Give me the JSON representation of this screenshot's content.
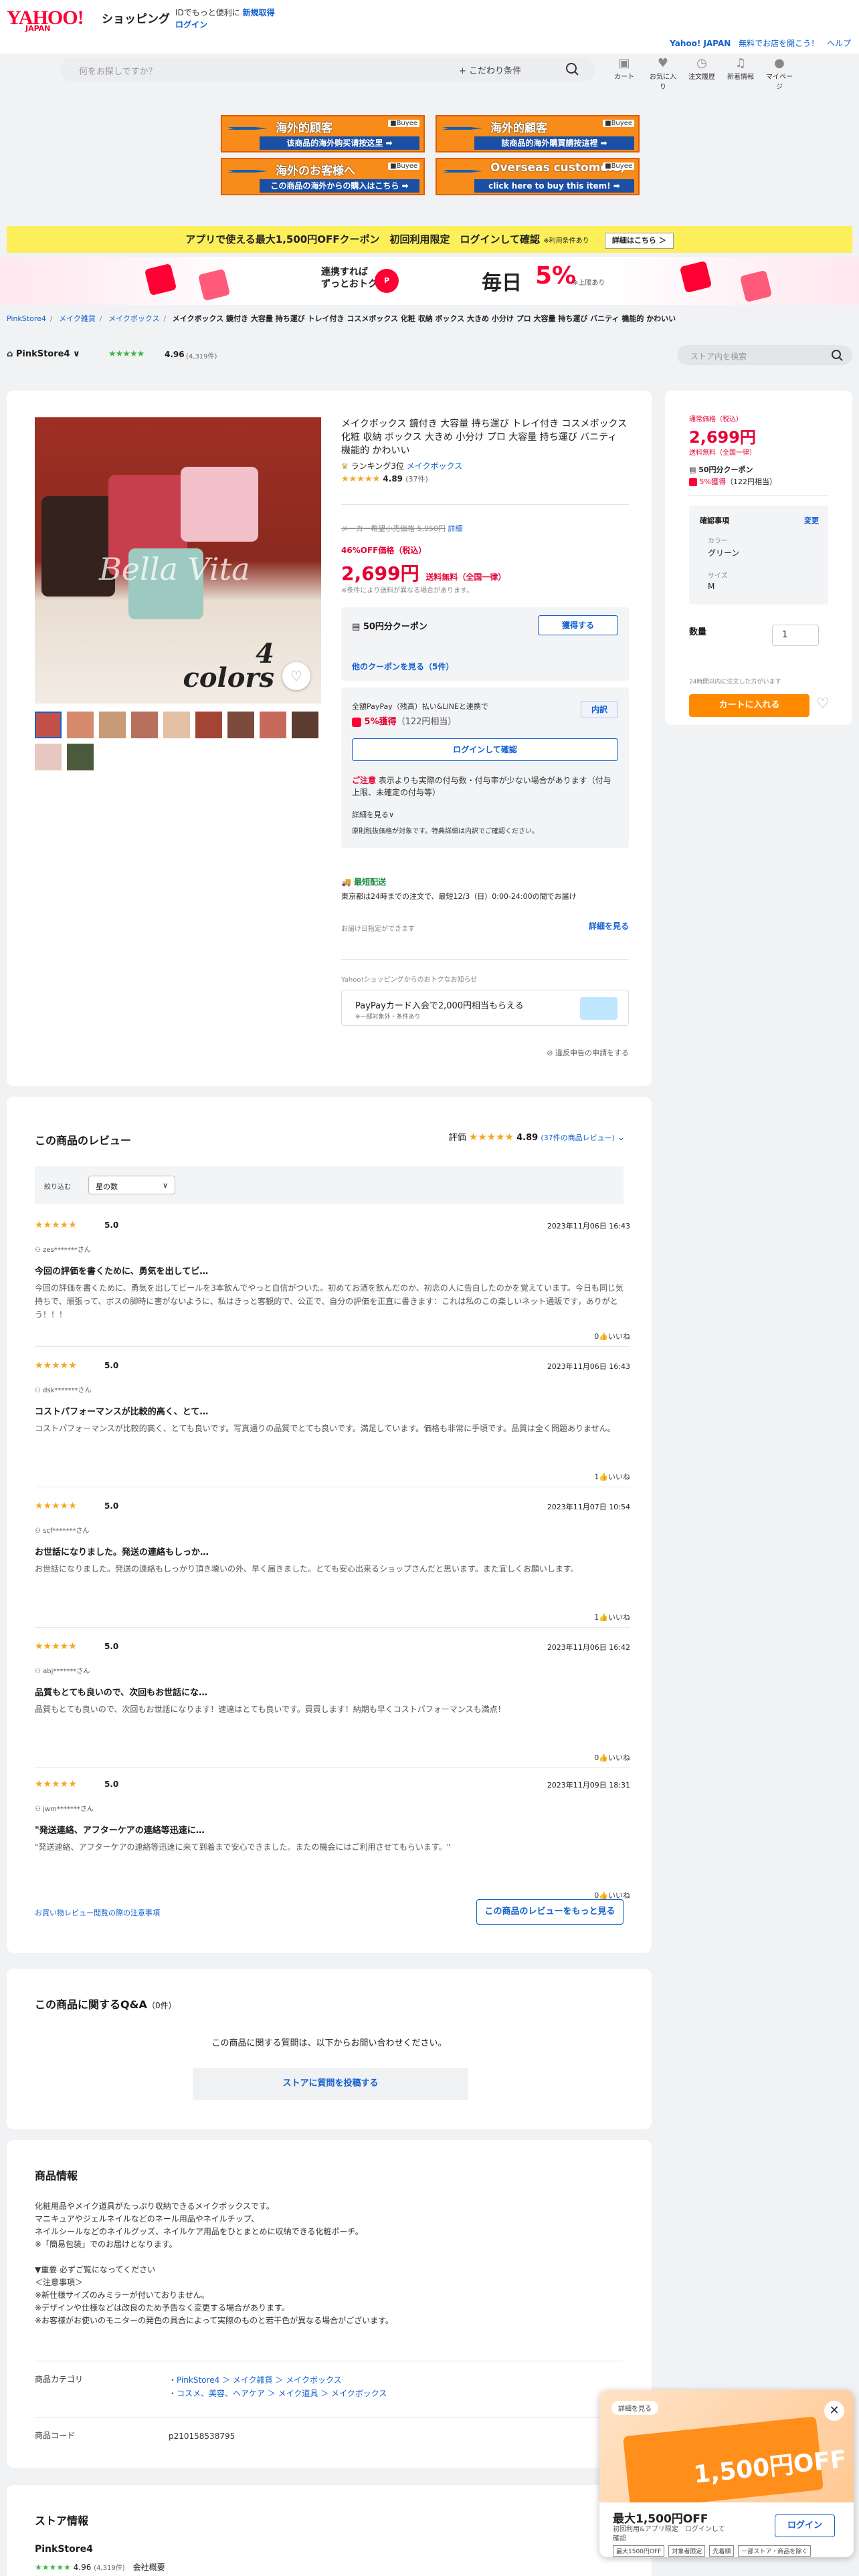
{
  "header": {
    "logo_text": "YAHOO!",
    "logo_sub": "JAPAN",
    "shop_label": "ショッピング",
    "promo_text": "IDでもっと便利に",
    "promo_link": "新規取得",
    "login": "ログイン",
    "yj_link": "Yahoo! JAPAN",
    "yj_link2": "無料でお店を開こう！",
    "help_link": "ヘルプ",
    "search_placeholder": "何をお探しですか？",
    "search_conditions": "+ こだわり条件",
    "nav": [
      {
        "icon": "cart-icon",
        "label": "カート"
      },
      {
        "icon": "heart-icon",
        "label": "お気に入り"
      },
      {
        "icon": "history-icon",
        "label": "注文履歴"
      },
      {
        "icon": "bell-icon",
        "label": "新着情報"
      },
      {
        "icon": "user-icon",
        "label": "マイページ"
      }
    ]
  },
  "ads": [
    {
      "title": "海外的顾客",
      "sub": "该商品的海外购买请按这里 ➡",
      "tag": "■Buyee"
    },
    {
      "title": "海外的顧客",
      "sub": "該商品的海外購買請按這裡 ➡",
      "tag": "■Buyee"
    },
    {
      "title": "海外のお客様へ",
      "sub": "この商品の海外からの購入はこちら ➡",
      "tag": "■Buyee"
    },
    {
      "title": "Overseas customers,",
      "sub": "click here to buy this item! ➡",
      "tag": "■Buyee"
    }
  ],
  "coupon_bar": {
    "text": "アプリで使える最大1,500円OFFクーポン　初回利用限定　ログインして確認",
    "note": "※利用条件あり",
    "detail": "詳細はこちら ＞"
  },
  "pay_banner": {
    "text": "連携すれば\nずっとおトク",
    "daily": "毎日",
    "percent": "5%",
    "note": "※上限あり"
  },
  "breadcrumb": [
    "PinkStore4",
    "メイク雑貨",
    "メイクボックス"
  ],
  "breadcrumb_current": "メイクボックス 鏡付き 大容量 持ち運び トレイ付き コスメボックス 化粧 収納 ボックス 大きめ 小分け プロ 大容量 持ち運び バニティ 機能的 かわいい",
  "store": {
    "name": "PinkStore4",
    "stars": "★★★★★",
    "rating": "4.96",
    "count": "(4,319件)",
    "search_placeholder": "ストア内を検索"
  },
  "product": {
    "title": "メイクボックス 鏡付き 大容量 持ち運び トレイ付き コスメボックス 化粧 収納 ボックス 大きめ 小分け プロ 大容量 持ち運び バニティ 機能的 かわいい",
    "rank_label": "ランキング3位",
    "rank_cat": "メイクボックス",
    "stars": "★★★★★",
    "rating": "4.89",
    "review_count": "(37件)",
    "image_text": "Bella Vita",
    "colors_text": "4\ncolors",
    "orig_price": "メーカー希望小売価格 5,950円",
    "orig_detail": "詳細",
    "discount": "46%OFF価格（税込）",
    "price": "2,699円",
    "ship": "送料無料（全国一律）",
    "note": "※条件により送料が異なる場合があります。",
    "coupon_title": "50円分クーポン",
    "coupon_get": "獲得する",
    "coupon_more": "他のクーポンを見る（5件）",
    "pay_line1": "全額PayPay（残高）払い&LINEと連携で",
    "pay_line2": "5%獲得",
    "pay_points": "（122円相当）",
    "pay_detail": "内訳",
    "pay_login": "ログインして確認",
    "caution_label": "ご注意",
    "caution": "表示よりも実際の付与数・付与率が少ない場合があります（付与上限、未確定の付与等）",
    "caution_more": "詳細を見る∨",
    "caution_foot": "原則税抜価格が対象です。特典詳細は内訳でご確認ください。",
    "ship_title": "最短配送",
    "ship_body": "東京都は24時までの注文で、最短12/3（日）0:00-24:00の間でお届け",
    "ship_date": "お届け日指定ができます",
    "ship_more": "詳細を見る",
    "yj_note": "Yahoo!ショッピングからのおトクなお知らせ",
    "card_offer": "PayPayカード入会で2,000円相当もらえる",
    "card_offer_sub": "※一部対象外・条件あり",
    "report": "⊘ 違反申告の申請をする"
  },
  "cart": {
    "label": "通常価格（税込）",
    "price": "2,699円",
    "ship": "送料無料（全国一律）",
    "coupon": "50円分クーポン",
    "points": "5%獲得",
    "points_note": "（122円相当）",
    "opt_title": "確認事項",
    "opt_change": "変更",
    "opt_k1": "カラー",
    "opt_v1": "グリーン",
    "opt_k2": "サイズ",
    "opt_v2": "M",
    "qty_label": "数量",
    "qty": "1",
    "qty_note": "24時間以内に注文した方がいます",
    "cart_btn": "カートに入れる"
  },
  "reviews": {
    "title": "この商品のレビュー",
    "eval_label": "評価",
    "stars": "★★★★★",
    "rating": "4.89",
    "count": "(37件の商品レビュー)",
    "filter_label": "絞り込む",
    "filter_value": "星の数",
    "items": [
      {
        "stars": "★★★★★",
        "score": "5.0",
        "date": "2023年11月06日 16:43",
        "user": "zes*******さん",
        "title": "今回の評価を書くために、勇気を出してビ…",
        "body": "今回の評価を書くために、勇気を出してビールを3本飲んでやっと自信がついた。初めてお酒を飲んだのか、初恋の人に告白したのかを覚えています。今日も同じ気持ちで、頑張って、ボスの脚時に害がないように、私はきっと客観的で、公正で、自分の評価を正直に書きます：これは私のこの楽しいネット通販です，ありがとう！！！",
        "likes": "0"
      },
      {
        "stars": "★★★★★",
        "score": "5.0",
        "date": "2023年11月06日 16:43",
        "user": "dsk*******さん",
        "title": "コストパフォーマンスが比較的高く、とて…",
        "body": "コストパフォーマンスが比較的高く、とても良いです。写真通りの品質でとても良いです。満足しています。価格も非常に手頃です。品質は全く問題ありません。",
        "likes": "1"
      },
      {
        "stars": "★★★★★",
        "score": "5.0",
        "date": "2023年11月07日 10:54",
        "user": "scf*******さん",
        "title": "お世話になりました。発送の連絡もしっか…",
        "body": "お世話になりました。発送の連絡もしっかり頂き壊いの外、早く届きました。とても安心出来るショップさんだと思います。また宜しくお願いします。",
        "likes": "1"
      },
      {
        "stars": "★★★★★",
        "score": "5.0",
        "date": "2023年11月06日 16:42",
        "user": "abj*******さん",
        "title": "品質もとても良いので、次回もお世話にな…",
        "body": "品質もとても良いので、次回もお世話になります！速達はとても良いです。買買します！納期も早くコストパフォーマンスも満点！",
        "likes": "0"
      },
      {
        "stars": "★★★★★",
        "score": "5.0",
        "date": "2023年11月09日 18:31",
        "user": "jwm*******さん",
        "title": "\"発送連絡、アフターケアの連絡等迅速に…",
        "body": "\"発送連絡、アフターケアの連絡等迅速に来て到着まで安心できました。またの機会にはご利用させてもらいます。\"",
        "likes": "0"
      }
    ],
    "like_label": "いいね",
    "guide": "お買い物レビュー閲覧の際の注意事項",
    "more": "この商品のレビューをもっと見る"
  },
  "qa": {
    "title": "この商品に関するQ&A",
    "count": "（0件）",
    "msg": "この商品に関する質問は、以下からお問い合わせください。",
    "btn": "ストアに質問を投稿する"
  },
  "info": {
    "title": "商品情報",
    "body": "化粧用品やメイク道具がたっぷり収納できるメイクボックスです。\nマニキュアやジェルネイルなどのネール用品やネイルチップ、\nネイルシールなどのネイルグッズ、ネイルケア用品をひとまとめに収納できる化粧ポーチ。\n※「簡易包装」でのお届けとなります。\n\n▼重要 必ずご覧になってください\n＜注意事項＞\n※新仕様サイズのみミラーが付いておりません。\n※デザインや仕様などは改良のため予告なく変更する場合があります。\n※お客様がお使いのモニターの発色の具合によって実際のものと若干色が異なる場合がございます。",
    "cat_label": "商品カテゴリ",
    "cat1": "・PinkStore4 ＞ メイク雑貨 ＞ メイクボックス",
    "cat2": "・コスメ、美容、ヘアケア ＞ メイク道具 ＞ メイクボックス",
    "code_label": "商品コード",
    "code": "p210158538795"
  },
  "store_info": {
    "title": "ストア情報",
    "name": "PinkStore4",
    "stars": "★★★★★",
    "rating": "4.96",
    "count": "(4,319件)",
    "company": "会社概要"
  },
  "popup": {
    "badge": "詳細を見る",
    "amount": "1,500円OFF",
    "main": "最大1,500円OFF",
    "sub": "初回利用&アプリ限定　ログインして\n確認",
    "login": "ログイン",
    "tags": [
      "最大1500円OFF",
      "対象者限定",
      "先着順",
      "一部ストア・商品を除く"
    ]
  }
}
